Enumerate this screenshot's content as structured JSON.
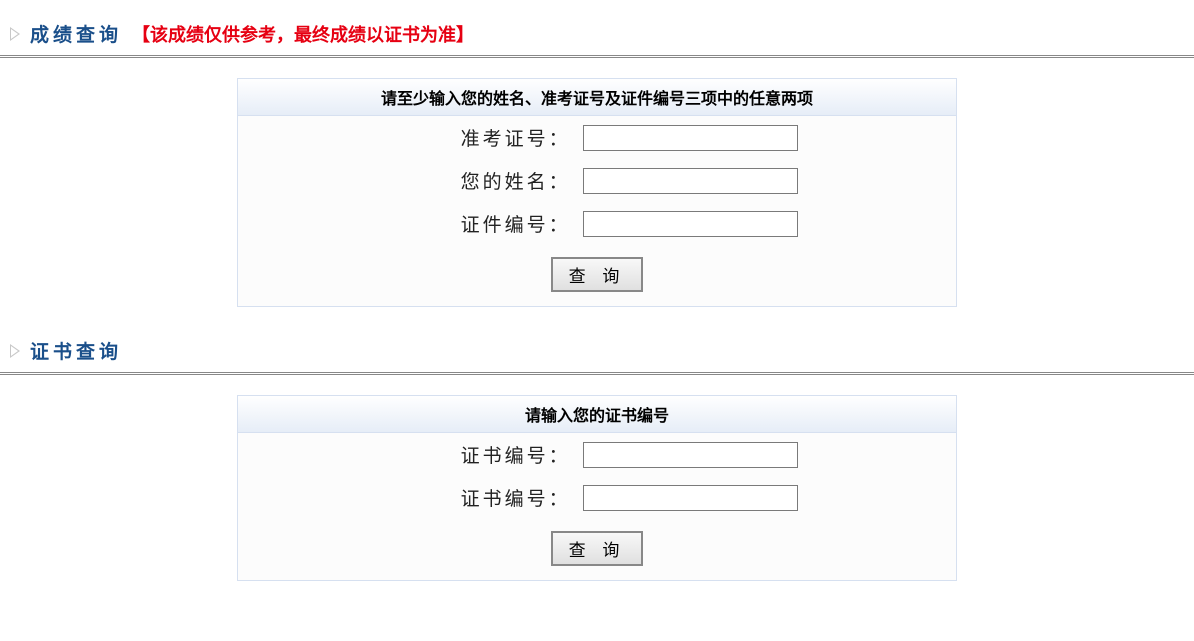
{
  "score_section": {
    "title": "成绩查询",
    "note": "【该成绩仅供参考，最终成绩以证书为准】",
    "form_header": "请至少输入您的姓名、准考证号及证件编号三项中的任意两项",
    "fields": {
      "ticket_label": "准考证号：",
      "ticket_value": "",
      "name_label": "您的姓名：",
      "name_value": "",
      "idnum_label": "证件编号：",
      "idnum_value": ""
    },
    "submit_label": "查 询"
  },
  "cert_section": {
    "title": "证书查询",
    "form_header": "请输入您的证书编号",
    "fields": {
      "cert1_label": "证书编号：",
      "cert1_value": "",
      "cert2_label": "证书编号：",
      "cert2_value": ""
    },
    "submit_label": "查 询"
  }
}
